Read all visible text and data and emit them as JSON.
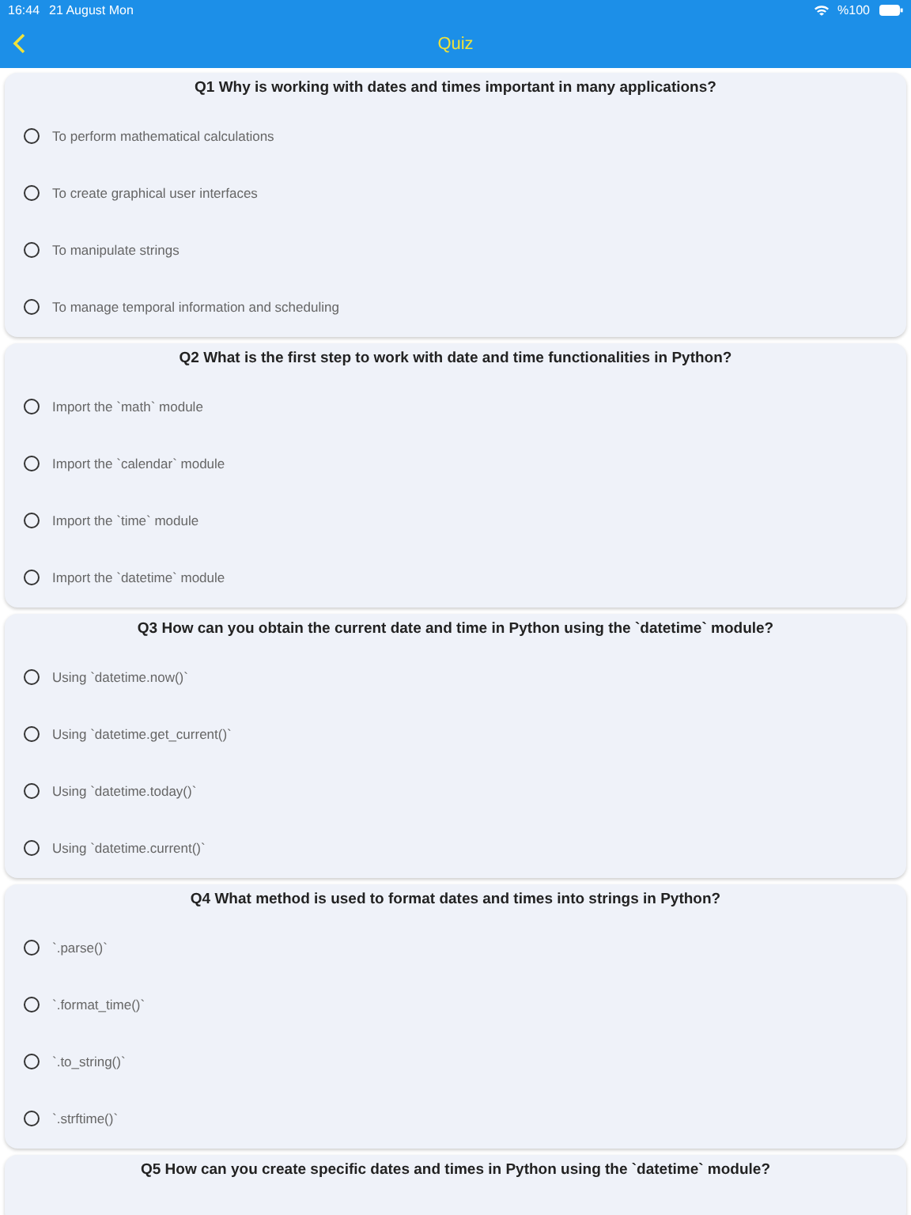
{
  "status_bar": {
    "time": "16:44",
    "date": "21 August Mon",
    "battery": "%100"
  },
  "header": {
    "title": "Quiz"
  },
  "questions": [
    {
      "title": "Q1 Why is working with dates and times important in many applications?",
      "options": [
        {
          "label": "To perform mathematical calculations",
          "selected": false
        },
        {
          "label": "To create graphical user interfaces",
          "selected": false
        },
        {
          "label": "To manipulate strings",
          "selected": false
        },
        {
          "label": "To manage temporal information and scheduling",
          "selected": false
        }
      ]
    },
    {
      "title": "Q2 What is the first step to work with date and time functionalities in Python?",
      "options": [
        {
          "label": "Import the `math` module",
          "selected": false
        },
        {
          "label": "Import the `calendar` module",
          "selected": false
        },
        {
          "label": "Import the `time` module",
          "selected": false
        },
        {
          "label": "Import the `datetime` module",
          "selected": false
        }
      ]
    },
    {
      "title": "Q3 How can you obtain the current date and time in Python using the `datetime` module?",
      "options": [
        {
          "label": "Using `datetime.now()`",
          "selected": false
        },
        {
          "label": "Using `datetime.get_current()`",
          "selected": false
        },
        {
          "label": "Using `datetime.today()`",
          "selected": false
        },
        {
          "label": "Using `datetime.current()`",
          "selected": false
        }
      ]
    },
    {
      "title": "Q4 What method is used to format dates and times into strings in Python?",
      "options": [
        {
          "label": "`.parse()`",
          "selected": false
        },
        {
          "label": "`.format_time()`",
          "selected": false
        },
        {
          "label": "`.to_string()`",
          "selected": false
        },
        {
          "label": "`.strftime()`",
          "selected": false
        }
      ]
    },
    {
      "title": "Q5 How can you create specific dates and times in Python using the `datetime` module?"
    }
  ]
}
